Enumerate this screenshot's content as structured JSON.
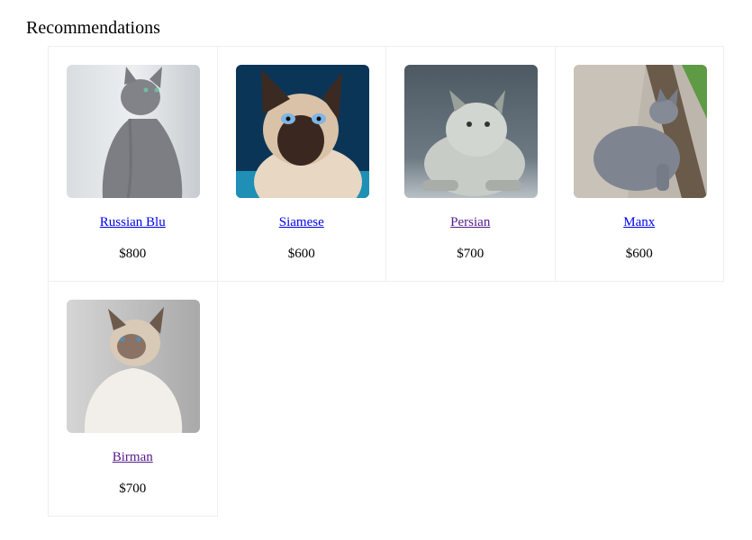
{
  "page": {
    "title": "Recommendations"
  },
  "products": [
    {
      "name": "Russian Blu",
      "price": "$800",
      "photo": "russian-blue-cat-photo",
      "visited": false
    },
    {
      "name": "Siamese",
      "price": "$600",
      "photo": "siamese-cat-photo",
      "visited": false
    },
    {
      "name": "Persian",
      "price": "$700",
      "photo": "persian-cat-photo",
      "visited": true
    },
    {
      "name": "Manx",
      "price": "$600",
      "photo": "manx-cat-photo",
      "visited": false
    },
    {
      "name": "Birman",
      "price": "$700",
      "photo": "birman-cat-photo",
      "visited": true
    }
  ],
  "colors": {
    "link": "#0000ee",
    "visited_link": "#551a8b",
    "card_border": "#efefef"
  }
}
